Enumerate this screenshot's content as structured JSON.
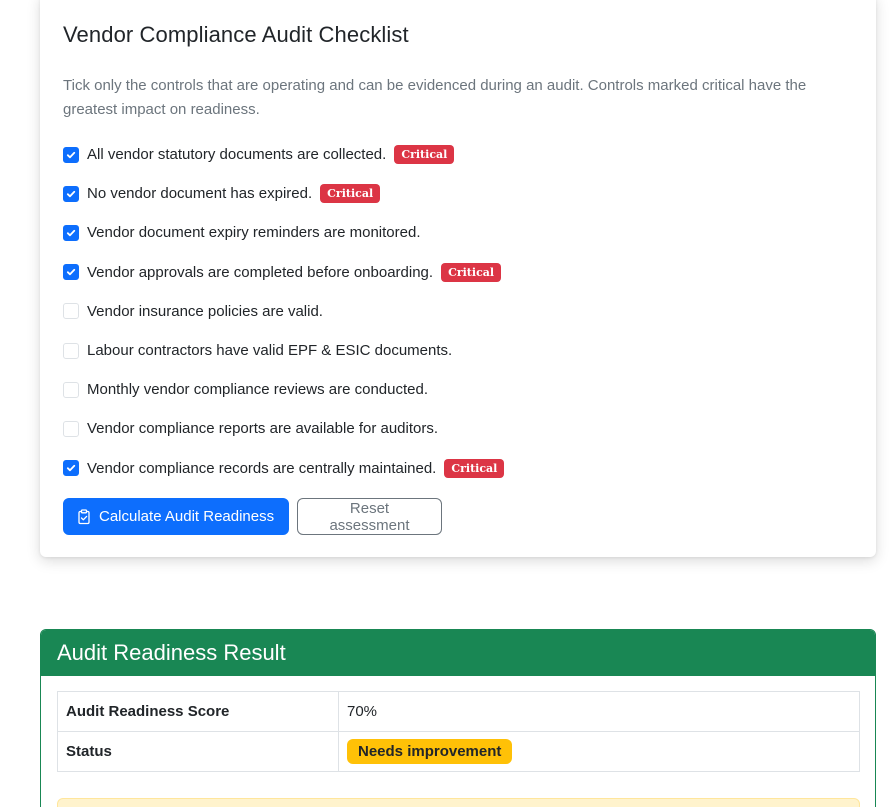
{
  "checklist": {
    "title": "Vendor Compliance Audit Checklist",
    "description": "Tick only the controls that are operating and can be evidenced during an audit. Controls marked critical have the greatest impact on readiness.",
    "critical_label": "Critical",
    "items": [
      {
        "label": "All vendor statutory documents are collected.",
        "checked": true,
        "critical": true
      },
      {
        "label": "No vendor document has expired.",
        "checked": true,
        "critical": true
      },
      {
        "label": "Vendor document expiry reminders are monitored.",
        "checked": true,
        "critical": false
      },
      {
        "label": "Vendor approvals are completed before onboarding.",
        "checked": true,
        "critical": true
      },
      {
        "label": "Vendor insurance policies are valid.",
        "checked": false,
        "critical": false
      },
      {
        "label": "Labour contractors have valid EPF & ESIC documents.",
        "checked": false,
        "critical": false
      },
      {
        "label": "Monthly vendor compliance reviews are conducted.",
        "checked": false,
        "critical": false
      },
      {
        "label": "Vendor compliance reports are available for auditors.",
        "checked": false,
        "critical": false
      },
      {
        "label": "Vendor compliance records are centrally maintained.",
        "checked": true,
        "critical": true
      }
    ],
    "calculate_label": "Calculate Audit Readiness",
    "reset_label": "Reset assessment"
  },
  "result": {
    "title": "Audit Readiness Result",
    "score_label": "Audit Readiness Score",
    "score_value": "70%",
    "status_label": "Status",
    "status_value": "Needs improvement"
  },
  "colors": {
    "primary": "#0d6efd",
    "critical": "#dc3545",
    "success": "#198754",
    "warning": "#ffc107"
  },
  "icons": {
    "calculate_button_icon": "clipboard-check-icon",
    "checkbox_icon": "checkmark-icon"
  }
}
